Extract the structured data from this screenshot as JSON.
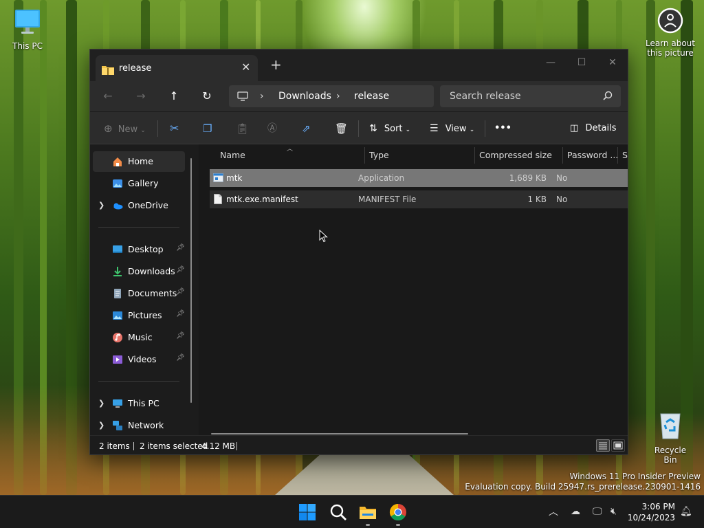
{
  "desktop": {
    "icons": {
      "this_pc": "This PC",
      "learn_line1": "Learn about",
      "learn_line2": "this picture",
      "recycle_bin": "Recycle Bin"
    },
    "watermark": {
      "line1": "Windows 11 Pro Insider Preview",
      "line2": "Evaluation copy. Build 25947.rs_prerelease.230901-1416"
    }
  },
  "explorer": {
    "tab_title": "release",
    "new_tab_label": "+",
    "breadcrumbs": [
      "Downloads",
      "release"
    ],
    "search_placeholder": "Search release",
    "toolbar": {
      "new_label": "New",
      "sort_label": "Sort",
      "view_label": "View",
      "more_label": "•••",
      "details_label": "Details"
    },
    "sidebar": {
      "home": "Home",
      "gallery": "Gallery",
      "onedrive": "OneDrive",
      "desktop": "Desktop",
      "downloads": "Downloads",
      "documents": "Documents",
      "pictures": "Pictures",
      "music": "Music",
      "videos": "Videos",
      "this_pc": "This PC",
      "network": "Network"
    },
    "columns": {
      "name": "Name",
      "type": "Type",
      "compressed_size": "Compressed size",
      "password": "Password ...",
      "size": "Si"
    },
    "files": [
      {
        "name": "mtk",
        "type": "Application",
        "compressed_size": "1,689 KB",
        "password": "No"
      },
      {
        "name": "mtk.exe.manifest",
        "type": "MANIFEST File",
        "compressed_size": "1 KB",
        "password": "No"
      }
    ],
    "status": {
      "items": "2 items",
      "selected": "2 items selected",
      "size": "4.12 MB"
    }
  },
  "taskbar": {
    "time": "3:06 PM",
    "date": "10/24/2023"
  },
  "colors": {
    "window_bg": "#1c1c1c",
    "chrome_bg": "#2c2c2c",
    "selection": "#777777",
    "windows_blue": "#0a84ff"
  }
}
